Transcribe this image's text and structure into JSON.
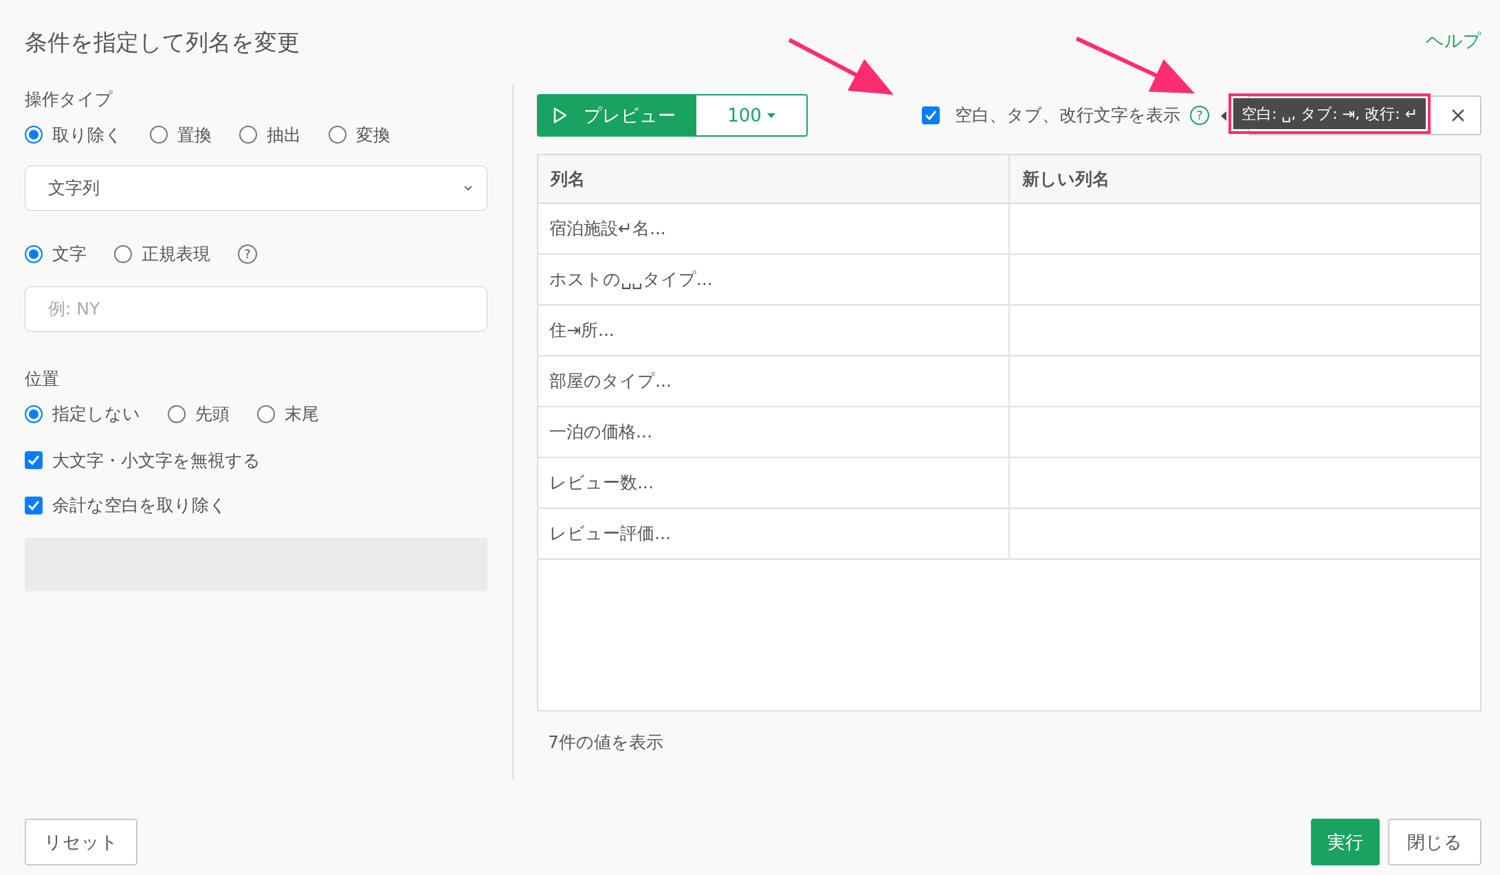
{
  "dialog": {
    "title": "条件を指定して列名を変更",
    "help_link": "ヘルプ"
  },
  "operation": {
    "label": "操作タイプ",
    "types": [
      {
        "label": "取り除く",
        "selected": true
      },
      {
        "label": "置換",
        "selected": false
      },
      {
        "label": "抽出",
        "selected": false
      },
      {
        "label": "変換",
        "selected": false
      }
    ],
    "data_type": {
      "value": "文字列"
    }
  },
  "match_modes": [
    {
      "label": "文字",
      "selected": true
    },
    {
      "label": "正規表現",
      "selected": false
    }
  ],
  "match_help": "?",
  "pattern_field": {
    "placeholder": "例: NY"
  },
  "position": {
    "label": "位置",
    "options": [
      {
        "label": "指定しない",
        "selected": true
      },
      {
        "label": "先頭",
        "selected": false
      },
      {
        "label": "末尾",
        "selected": false
      }
    ]
  },
  "options": [
    {
      "label": "大文字・小文字を無視する",
      "checked": true
    },
    {
      "label": "余計な空白を取り除く",
      "checked": true
    }
  ],
  "preview": {
    "button": "プレビュー",
    "count": "100",
    "show_whitespace": {
      "label": "空白、タブ、改行文字を表示",
      "checked": true
    },
    "help": "?",
    "tooltip": "空白: ␣, タブ: ⇥, 改行: ↵"
  },
  "table": {
    "columns": [
      "列名",
      "新しい列名"
    ],
    "rows": [
      "宿泊施設↵名...",
      "ホストの␣␣タイプ...",
      "住⇥所...",
      "部屋のタイプ...",
      "一泊の価格...",
      "レビュー数...",
      "レビュー評価..."
    ]
  },
  "summary": "7件の値を表示",
  "footer": {
    "reset": "リセット",
    "run": "実行",
    "close": "閉じる"
  }
}
